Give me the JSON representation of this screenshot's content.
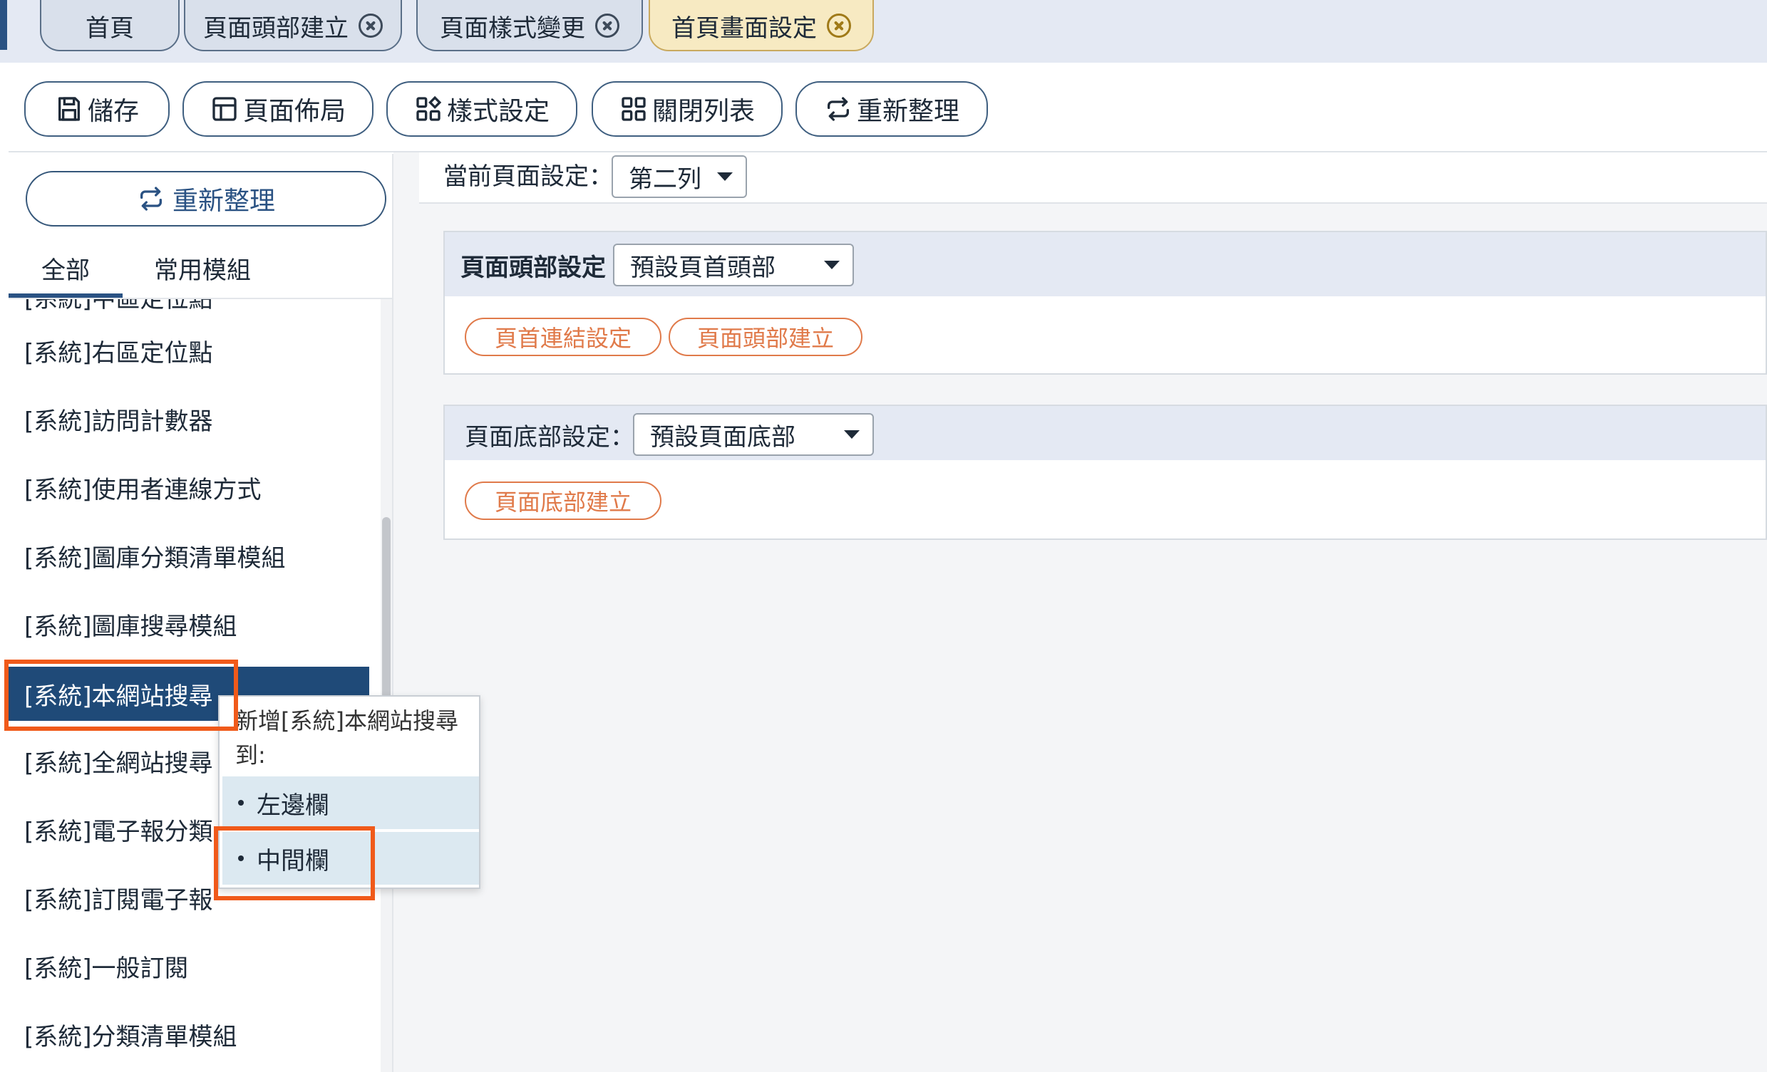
{
  "tabs": [
    {
      "label": "首頁",
      "closable": false,
      "active": false
    },
    {
      "label": "頁面頭部建立",
      "closable": true,
      "active": false
    },
    {
      "label": "頁面樣式變更",
      "closable": true,
      "active": false
    },
    {
      "label": "首頁畫面設定",
      "closable": true,
      "active": true
    }
  ],
  "toolbar": {
    "save": "儲存",
    "layout": "頁面佈局",
    "style": "樣式設定",
    "close_list": "關閉列表",
    "refresh": "重新整理"
  },
  "sidebar": {
    "refresh": "重新整理",
    "tabs": [
      "全部",
      "常用模組"
    ],
    "items": [
      "[系統]中區定位點",
      "[系統]右區定位點",
      "[系統]訪問計數器",
      "[系統]使用者連線方式",
      "[系統]圖庫分類清單模組",
      "[系統]圖庫搜尋模組",
      "[系統]本網站搜尋",
      "[系統]全網站搜尋",
      "[系統]電子報分類",
      "[系統]訂閱電子報",
      "[系統]一般訂閱",
      "[系統]分類清單模組"
    ],
    "selected_index": 6
  },
  "main": {
    "current_layout_label": "當前頁面設定：",
    "current_layout_value": "第二列",
    "header_panel": {
      "title": "頁面頭部設定",
      "select_value": "預設頁首頭部",
      "links": [
        "頁首連結設定",
        "頁面頭部建立"
      ]
    },
    "footer_panel": {
      "title": "頁面底部設定：",
      "select_value": "預設頁面底部",
      "links": [
        "頁面底部建立"
      ]
    }
  },
  "popup": {
    "title": "新增[系統]本網站搜尋到:",
    "options": [
      "左邊欄",
      "中間欄"
    ]
  },
  "colors": {
    "accent": "#1f4a78",
    "highlight": "#f05a1a",
    "link": "#e07a4a",
    "active_tab": "#f7eac2"
  }
}
